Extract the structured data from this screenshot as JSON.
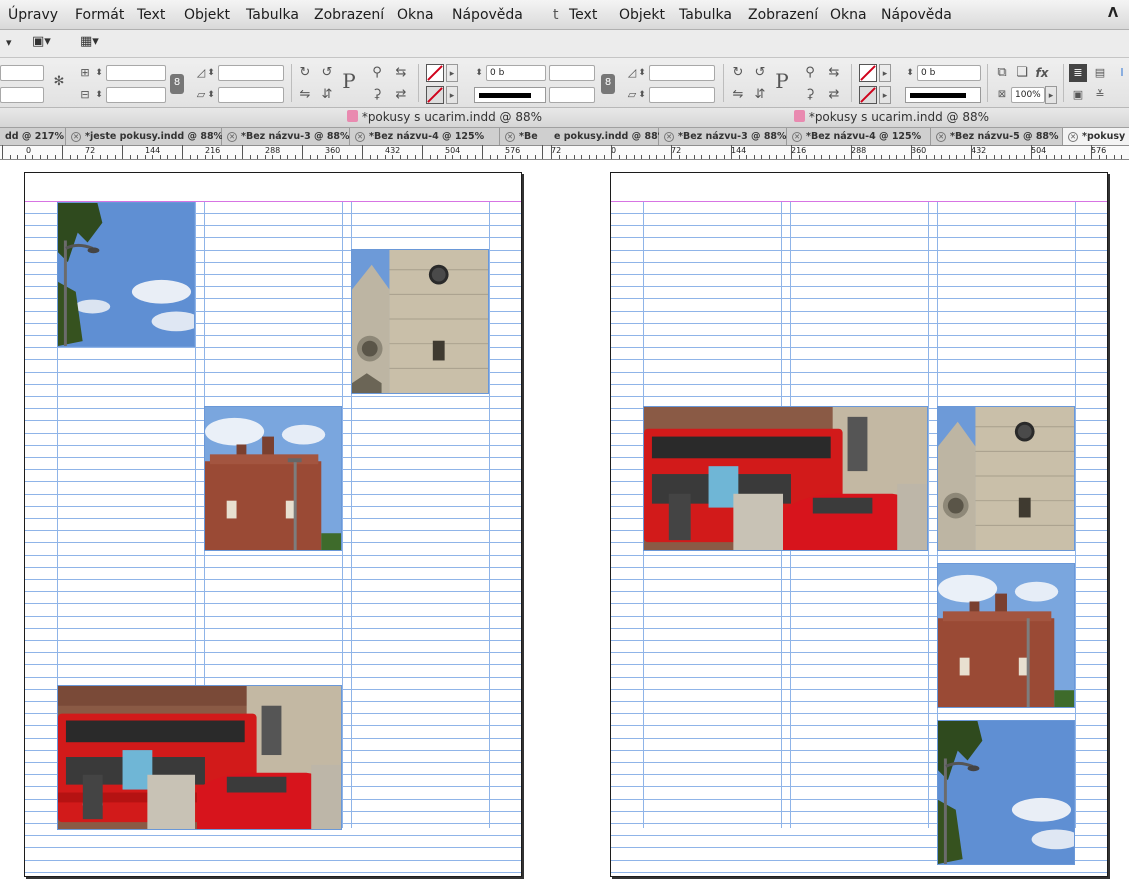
{
  "left": {
    "menu": [
      "Úpravy",
      "Formát",
      "Text",
      "Objekt",
      "Tabulka",
      "Zobrazení",
      "Okna",
      "Nápověda"
    ],
    "stroke_weight": "0 b",
    "document_title": "*pokusy s ucarim.indd @ 88%",
    "tabs": [
      {
        "label": "dd @ 217%",
        "close": false
      },
      {
        "label": "*jeste pokusy.indd @ 88%",
        "close": true
      },
      {
        "label": "*Bez názvu-3 @ 88%",
        "close": true
      },
      {
        "label": "*Bez názvu-4 @ 125%",
        "close": true
      },
      {
        "label": "*Be",
        "close": true
      }
    ],
    "ruler": [
      "0",
      "72",
      "144",
      "216",
      "288",
      "360",
      "432",
      "504",
      "576"
    ]
  },
  "right": {
    "menu": [
      "Text",
      "Objekt",
      "Tabulka",
      "Zobrazení",
      "Okna",
      "Nápověda"
    ],
    "stroke_weight": "0 b",
    "opacity": "100%",
    "document_title": "*pokusy s ucarim.indd @ 88%",
    "tabs": [
      {
        "label": "e pokusy.indd @ 88%",
        "close": false
      },
      {
        "label": "*Bez názvu-3 @ 88%",
        "close": true
      },
      {
        "label": "*Bez názvu-4 @ 125%",
        "close": true
      },
      {
        "label": "*Bez názvu-5 @ 88%",
        "close": true
      },
      {
        "label": "*pokusy",
        "close": true
      }
    ],
    "ruler": [
      "72",
      "0",
      "72",
      "144",
      "216",
      "288",
      "360",
      "432",
      "504",
      "576"
    ]
  },
  "icons": {
    "fx": "fx",
    "paragraph": "P"
  },
  "colors": {
    "baseline_grid": "#8fb4e8",
    "margin_guide": "#d774e3",
    "frame_edge": "#6a98d8"
  }
}
